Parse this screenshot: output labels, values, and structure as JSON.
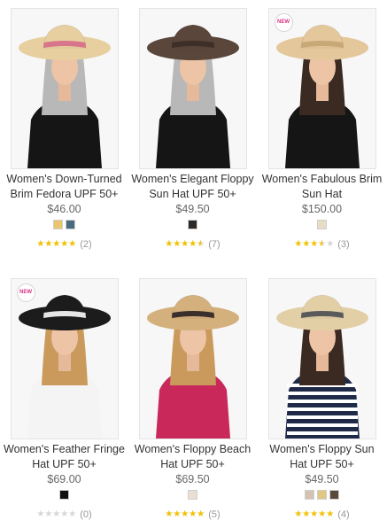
{
  "products": [
    {
      "name": "Women's Down-Turned Brim Fedora UPF 50+",
      "price": "$46.00",
      "is_new": false,
      "swatches": [
        "#e8c56e",
        "#4a6a7e"
      ],
      "rating": 5,
      "review_count": "(2)",
      "hat_color": "#e7cfa0",
      "band_color": "#d9758a",
      "top_color": "#151515"
    },
    {
      "name": "Women's Elegant Floppy Sun Hat UPF 50+",
      "price": "$49.50",
      "is_new": false,
      "swatches": [
        "#2f2a26"
      ],
      "rating": 4.5,
      "review_count": "(7)",
      "hat_color": "#5a463a",
      "band_color": "#3d2f28",
      "top_color": "#151515"
    },
    {
      "name": "Women's Fabulous Brim Sun Hat",
      "price": "$150.00",
      "is_new": true,
      "swatches": [
        "#e9dcc5"
      ],
      "rating": 3.5,
      "review_count": "(3)",
      "hat_color": "#e4c79a",
      "band_color": "#c8a877",
      "top_color": "#151515"
    },
    {
      "name": "Women's Feather Fringe Hat UPF 50+",
      "price": "$69.00",
      "is_new": true,
      "swatches": [
        "#111111"
      ],
      "rating": 0,
      "review_count": "(0)",
      "hat_color": "#1c1c1c",
      "band_color": "#e6e6e6",
      "top_color": "#f4f4f4"
    },
    {
      "name": "Women's Floppy Beach Hat UPF 50+",
      "price": "$69.50",
      "is_new": false,
      "swatches": [
        "#e9dfd3"
      ],
      "rating": 5,
      "review_count": "(5)",
      "hat_color": "#d4b07d",
      "band_color": "#3a2f2a",
      "top_color": "#c8285a"
    },
    {
      "name": "Women's Floppy Sun Hat UPF 50+",
      "price": "$49.50",
      "is_new": false,
      "swatches": [
        "#d2c3b0",
        "#e2c781",
        "#5a4a3c"
      ],
      "rating": 5,
      "review_count": "(4)",
      "hat_color": "#e2cfa6",
      "band_color": "#5a5a5a",
      "top_color": "#1f2a48"
    }
  ],
  "badge_text": "NEW",
  "star_glyphs": "★★★★★"
}
